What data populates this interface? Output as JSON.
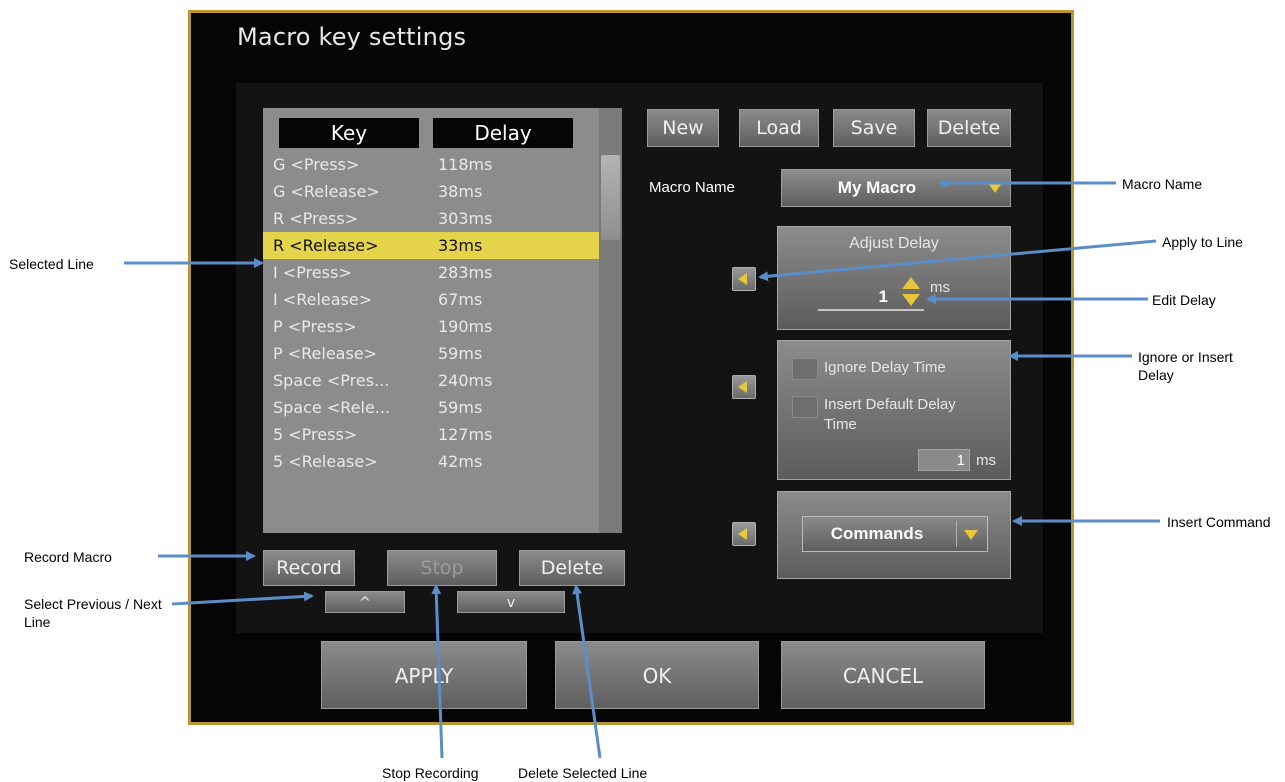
{
  "dialog": {
    "title": "Macro key settings",
    "list": {
      "headers": {
        "key": "Key",
        "delay": "Delay"
      },
      "rows": [
        {
          "key": "G <Press>",
          "delay": "118ms"
        },
        {
          "key": "G <Release>",
          "delay": "38ms"
        },
        {
          "key": "R <Press>",
          "delay": "303ms"
        },
        {
          "key": "R <Release>",
          "delay": "33ms"
        },
        {
          "key": "I <Press>",
          "delay": "283ms"
        },
        {
          "key": "I <Release>",
          "delay": "67ms"
        },
        {
          "key": "P <Press>",
          "delay": "190ms"
        },
        {
          "key": "P <Release>",
          "delay": "59ms"
        },
        {
          "key": "Space <Pres...",
          "delay": "240ms"
        },
        {
          "key": "Space <Rele...",
          "delay": "59ms"
        },
        {
          "key": "5 <Press>",
          "delay": "127ms"
        },
        {
          "key": "5 <Release>",
          "delay": "42ms"
        }
      ]
    },
    "toolbar": {
      "new": "New",
      "load": "Load",
      "save": "Save",
      "delete": "Delete"
    },
    "macro_name": {
      "label": "Macro Name",
      "value": "My Macro"
    },
    "adjust_delay": {
      "title": "Adjust Delay",
      "value": "1",
      "unit": "ms"
    },
    "ignore_delay": {
      "label": "Ignore Delay Time",
      "insert_label": "Insert Default Delay Time",
      "value": "1",
      "unit": "ms"
    },
    "commands": {
      "value": "Commands"
    },
    "record_controls": {
      "record": "Record",
      "stop": "Stop",
      "delete": "Delete",
      "prev": "^",
      "next": "v"
    },
    "footer": {
      "apply": "APPLY",
      "ok": "OK",
      "cancel": "CANCEL"
    }
  },
  "annotations": {
    "selected_line": "Selected Line",
    "record_macro": "Record Macro",
    "select_prev_next": "Select Previous / Next Line",
    "macro_name": "Macro Name",
    "apply_to_line": "Apply to Line",
    "edit_delay": "Edit Delay",
    "ignore_insert": "Ignore or Insert Delay",
    "insert_command": "Insert Command",
    "stop_recording": "Stop Recording",
    "delete_selected": "Delete Selected Line"
  },
  "colors": {
    "frame": "#b8952e",
    "selection": "#e5d34a",
    "accent_arrow": "#e6c936",
    "annotation_arrow": "#5b8ec9"
  }
}
